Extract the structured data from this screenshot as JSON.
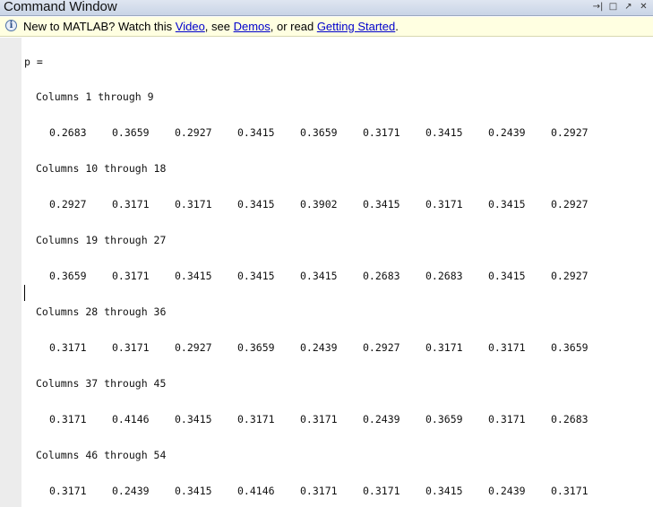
{
  "window": {
    "title": "Command Window",
    "controls": [
      "→|",
      "□",
      "↗",
      "✕"
    ]
  },
  "infobar": {
    "prefix": "New to MATLAB? Watch this ",
    "video_link": "Video",
    "sep1": ", see ",
    "demos_link": "Demos",
    "sep2": ", or read ",
    "getting_started_link": "Getting Started",
    "suffix": "."
  },
  "console": {
    "var_line": "p =",
    "blocks": [
      {
        "header": "Columns 1 through 9",
        "values": [
          "0.2683",
          "0.3659",
          "0.2927",
          "0.3415",
          "0.3659",
          "0.3171",
          "0.3415",
          "0.2439",
          "0.2927"
        ]
      },
      {
        "header": "Columns 10 through 18",
        "values": [
          "0.2927",
          "0.3171",
          "0.3171",
          "0.3415",
          "0.3902",
          "0.3415",
          "0.3171",
          "0.3415",
          "0.2927"
        ]
      },
      {
        "header": "Columns 19 through 27",
        "values": [
          "0.3659",
          "0.3171",
          "0.3415",
          "0.3415",
          "0.3415",
          "0.2683",
          "0.2683",
          "0.3415",
          "0.2927"
        ]
      },
      {
        "header": "Columns 28 through 36",
        "values": [
          "0.3171",
          "0.3171",
          "0.2927",
          "0.3659",
          "0.2439",
          "0.2927",
          "0.3171",
          "0.3171",
          "0.3659"
        ]
      },
      {
        "header": "Columns 37 through 45",
        "values": [
          "0.3171",
          "0.4146",
          "0.3415",
          "0.3171",
          "0.3171",
          "0.2439",
          "0.3659",
          "0.3171",
          "0.2683"
        ]
      },
      {
        "header": "Columns 46 through 54",
        "values": [
          "0.3171",
          "0.2439",
          "0.3415",
          "0.4146",
          "0.3171",
          "0.3171",
          "0.3415",
          "0.2439",
          "0.3171"
        ]
      }
    ]
  }
}
